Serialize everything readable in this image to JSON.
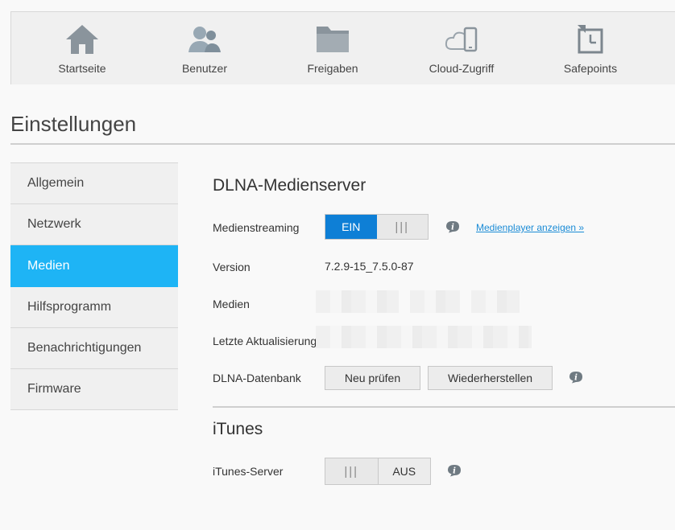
{
  "nav": {
    "items": [
      {
        "label": "Startseite",
        "icon": "home-icon"
      },
      {
        "label": "Benutzer",
        "icon": "users-icon"
      },
      {
        "label": "Freigaben",
        "icon": "folder-icon"
      },
      {
        "label": "Cloud-Zugriff",
        "icon": "cloud-phone-icon"
      },
      {
        "label": "Safepoints",
        "icon": "safepoint-icon"
      }
    ]
  },
  "page": {
    "title": "Einstellungen"
  },
  "menu": {
    "items": [
      {
        "label": "Allgemein"
      },
      {
        "label": "Netzwerk"
      },
      {
        "label": "Medien"
      },
      {
        "label": "Hilfsprogramm"
      },
      {
        "label": "Benachrichtigungen"
      },
      {
        "label": "Firmware"
      }
    ],
    "active": "Medien"
  },
  "dlna": {
    "title": "DLNA-Medienserver",
    "streaming_label": "Medienstreaming",
    "streaming_state": "EIN",
    "grip": "|||",
    "player_link": "Medienplayer anzeigen »",
    "version_label": "Version",
    "version_value": "7.2.9-15_7.5.0-87",
    "media_label": "Medien",
    "last_update_label": "Letzte Aktualisierung",
    "db_label": "DLNA-Datenbank",
    "rescan_button": "Neu prüfen",
    "restore_button": "Wiederherstellen"
  },
  "itunes": {
    "title": "iTunes",
    "server_label": "iTunes-Server",
    "grip": "|||",
    "server_state": "AUS"
  },
  "colors": {
    "accent": "#1eb4f5",
    "toggle_on": "#0e7fd6",
    "link": "#1a8bd6"
  }
}
